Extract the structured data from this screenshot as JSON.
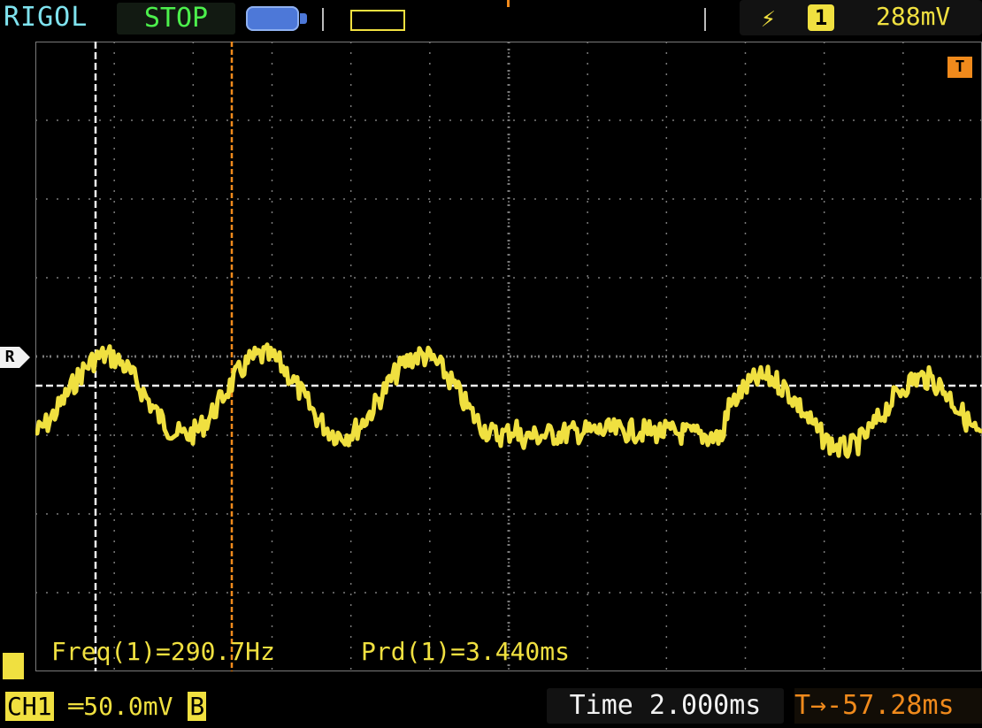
{
  "header": {
    "brand": "RIGOL",
    "run_state": "STOP",
    "trigger_edge_icon": "rising-edge-icon",
    "trigger_channel": "1",
    "trigger_level": "288mV"
  },
  "markers": {
    "reference": "R",
    "trigger": "T"
  },
  "measurements": {
    "freq": "Freq(1)=290.7Hz",
    "period": "Prd(1)=3.440ms"
  },
  "footer": {
    "channel_label": "CH1",
    "channel_scale": "50.0mV",
    "coupling": "B",
    "timebase": "Time 2.000ms",
    "trigger_offset": "T→-57.28ms"
  },
  "colors": {
    "trace": "#f0e040",
    "grid": "#7a7a7a",
    "cursor": "#f08a1c",
    "brand": "#7fe3ef",
    "stop": "#4cf04c"
  }
}
